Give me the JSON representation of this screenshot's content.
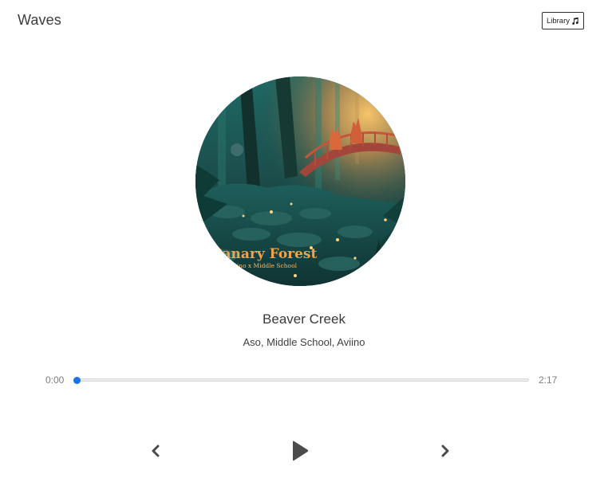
{
  "app": {
    "title": "Waves"
  },
  "header": {
    "library_label": "Library",
    "library_icon": "music-note-icon"
  },
  "now_playing": {
    "album_art": {
      "title_text": "Canary Forest",
      "subtitle_text": "Aviino x Middle School"
    },
    "track_title": "Beaver Creek",
    "artists": "Aso, Middle School, Aviino",
    "current_time": "0:00",
    "total_time": "2:17",
    "progress_fraction": 0.0
  },
  "controls": {
    "prev_icon": "chevron-left-icon",
    "play_icon": "play-icon",
    "next_icon": "chevron-right-icon"
  },
  "colors": {
    "accent": "#1a73e8",
    "text": "#3f3f3f",
    "muted": "#7d7d7d"
  }
}
